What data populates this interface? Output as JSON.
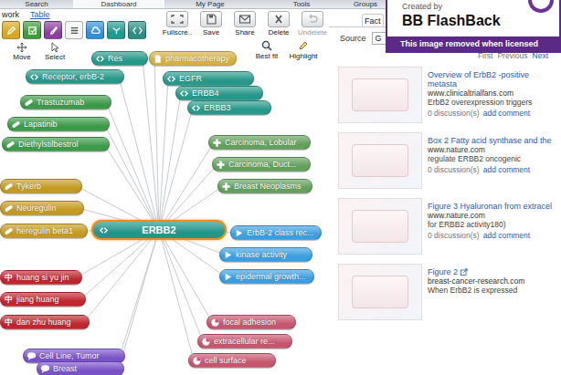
{
  "app_tabs": [
    {
      "label": "Search",
      "selected": false
    },
    {
      "label": "Dashboard",
      "selected": true
    },
    {
      "label": "My Page",
      "selected": false
    },
    {
      "label": "Tools",
      "selected": false
    },
    {
      "label": "Groups",
      "selected": false
    }
  ],
  "view_tabs": [
    {
      "label": "work",
      "selected": true
    },
    {
      "label": "Table",
      "selected": false
    }
  ],
  "palette": [
    {
      "color": "#d9a81e"
    },
    {
      "color": "#3f9a3a"
    },
    {
      "color": "#8a3f9e"
    },
    {
      "color": "#f4f4f4"
    },
    {
      "color": "#2f8fd8"
    },
    {
      "color": "#1f9a8e"
    },
    {
      "color": "#2a8f86"
    }
  ],
  "tools": [
    {
      "label": "Move"
    },
    {
      "label": "Select"
    }
  ],
  "actions": [
    {
      "label": "Fullscre..",
      "disabled": false
    },
    {
      "label": "Save",
      "disabled": false
    },
    {
      "label": "Share",
      "disabled": false
    },
    {
      "label": "Delete",
      "disabled": false
    },
    {
      "label": "Undelete",
      "disabled": true
    }
  ],
  "view_actions": [
    {
      "label": "Best fit"
    },
    {
      "label": "Highlight"
    }
  ],
  "map": {
    "center": {
      "label": "ERBB2",
      "selected": true
    },
    "nodes": [
      {
        "label": "Res",
        "kind": "gene",
        "color": "#26998a"
      },
      {
        "label": "pharmacotherapy",
        "kind": "mesh",
        "color": "#d4b03e"
      },
      {
        "label": "Receptor, erbB-2",
        "kind": "gene",
        "color": "#26998a"
      },
      {
        "label": "EGFR",
        "kind": "gene",
        "color": "#26998a"
      },
      {
        "label": "ERBB4",
        "kind": "gene",
        "color": "#26998a"
      },
      {
        "label": "ERBB3",
        "kind": "gene",
        "color": "#26998a"
      },
      {
        "label": "Trastuzumab",
        "kind": "drug",
        "color": "#3c9a48"
      },
      {
        "label": "Lapatinib",
        "kind": "drug",
        "color": "#3c9a48"
      },
      {
        "label": "Diethylstilbestrol",
        "kind": "drug",
        "color": "#3c9a48"
      },
      {
        "label": "Carcinoma, Lobular",
        "kind": "disease",
        "color": "#62a05c"
      },
      {
        "label": "Carcinoma, Duct...",
        "kind": "disease",
        "color": "#62a05c"
      },
      {
        "label": "Breast Neoplasms",
        "kind": "disease",
        "color": "#62a05c"
      },
      {
        "label": "Tykerb",
        "kind": "compound",
        "color": "#c49a22"
      },
      {
        "label": "Neuregulin",
        "kind": "compound",
        "color": "#c49a22"
      },
      {
        "label": "heregulin beta1",
        "kind": "compound",
        "color": "#c49a22"
      },
      {
        "label": "ErbB-2 class rec...",
        "kind": "function",
        "color": "#3a9ee0"
      },
      {
        "label": "kinase activity",
        "kind": "function",
        "color": "#3a9ee0"
      },
      {
        "label": "epidermal growth...",
        "kind": "function",
        "color": "#3a9ee0"
      },
      {
        "label": "huang si yu jin",
        "kind": "herb",
        "color": "#c0262d",
        "icon": "中"
      },
      {
        "label": "jiang huang",
        "kind": "herb",
        "color": "#c0262d",
        "icon": "中"
      },
      {
        "label": "dan zhu huang",
        "kind": "herb",
        "color": "#c0262d",
        "icon": "中"
      },
      {
        "label": "focal adhesion",
        "kind": "component",
        "color": "#c5566e"
      },
      {
        "label": "extracellular re...",
        "kind": "component",
        "color": "#c5566e"
      },
      {
        "label": "cell surface",
        "kind": "component",
        "color": "#c5566e"
      },
      {
        "label": "Cell Line, Tumor",
        "kind": "cell",
        "color": "#7a52c8"
      },
      {
        "label": "Breast",
        "kind": "cell",
        "color": "#7a52c8"
      }
    ]
  },
  "side_tabs": [
    {
      "label": "Fact",
      "selected": true
    }
  ],
  "source": {
    "label": "Source",
    "value": "G"
  },
  "pager": [
    {
      "label": "First",
      "disabled": true
    },
    {
      "label": "Previous",
      "disabled": true
    },
    {
      "label": "Next",
      "disabled": false
    }
  ],
  "results": [
    {
      "title": "Overview of ErbB2 -positive metasta",
      "site": "www.clinicaltrialfans.com",
      "snippet": "ErbB2 overexpression triggers",
      "discussions": "0 discussion(s)",
      "comment": "add comment",
      "new_window": false
    },
    {
      "title": "Box 2  Fatty acid synthase and the",
      "site": "www.nature.com",
      "snippet": "regulate ERBB2 oncogenic",
      "discussions": "0 discussion(s)",
      "comment": "add comment",
      "new_window": false
    },
    {
      "title": "Figure 3  Hyaluronan from extracel",
      "site": "www.nature.com",
      "snippet": "for ERBB2 activity180)",
      "discussions": "0 discussion(s)",
      "comment": "add comment",
      "new_window": false
    },
    {
      "title": "Figure 2",
      "site": "breast-cancer-research.com",
      "snippet": "When ErbB2 is expressed",
      "new_window": true
    }
  ],
  "watermark": {
    "caption": "Created by",
    "brand": "BB FlashBack",
    "notice": "This image removed when licensed"
  }
}
